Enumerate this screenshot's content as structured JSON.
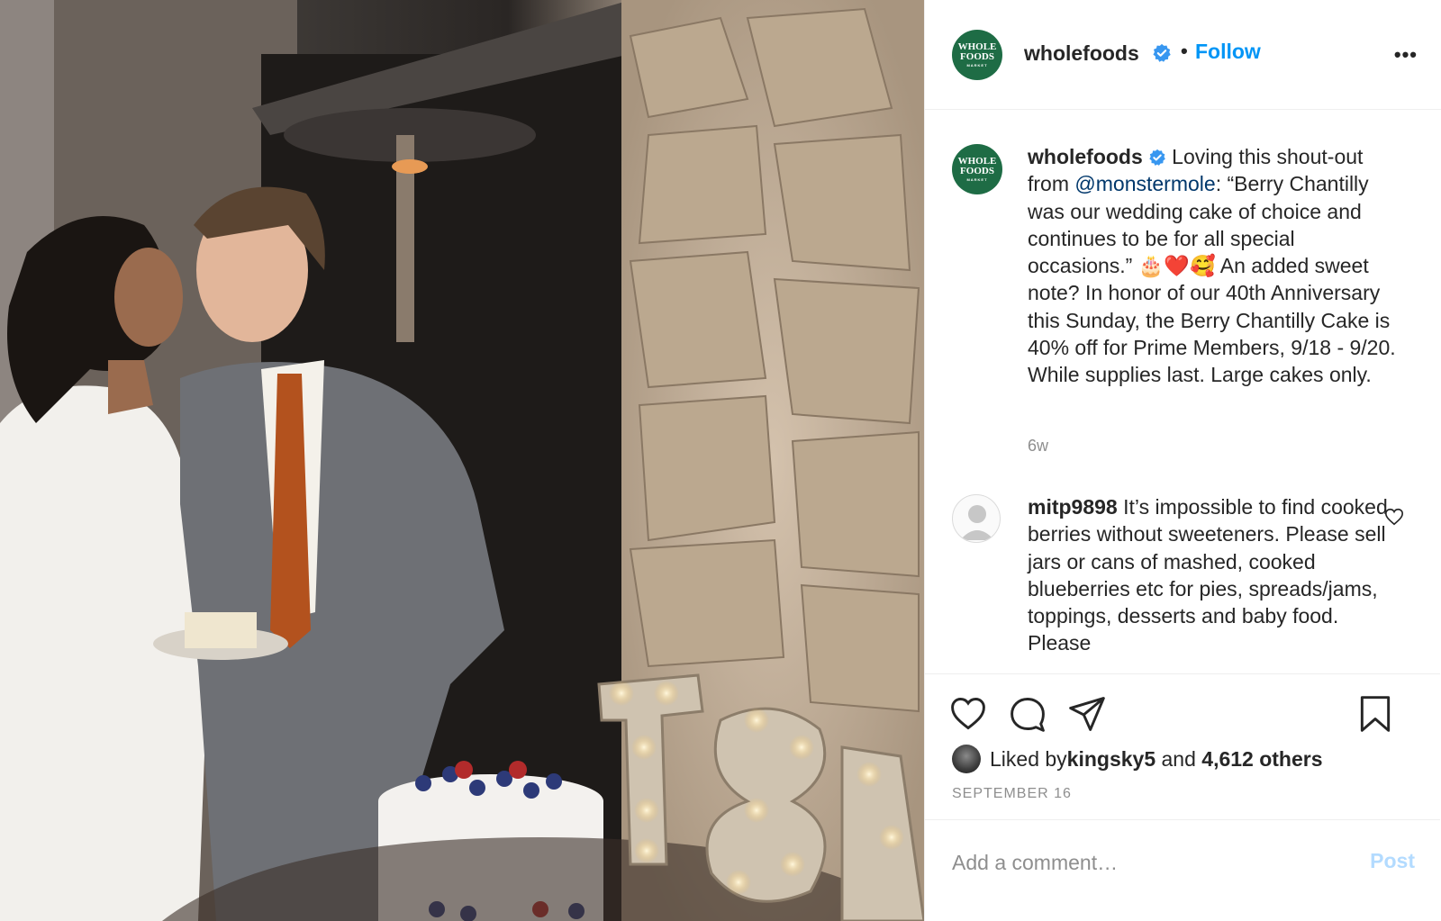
{
  "post": {
    "account": "wholefoods",
    "logo": {
      "line1": "WHOLE",
      "line2": "FOODS",
      "line3": "MARKET"
    },
    "follow_label": "Follow",
    "separator": "•",
    "more_label": "•••"
  },
  "caption": {
    "user": "wholefoods",
    "text_before_mention": " Loving this shout-out from ",
    "mention": "@monstermole",
    "text_after_mention": ": “Berry Chantilly was our wedding cake of choice and continues to be for all special occasions.” 🎂❤️🥰 An added sweet note? In honor of our 40th Anniversary this Sunday, the Berry Chantilly Cake is 40% off for Prime Members, 9/18 - 9/20. While supplies last. Large cakes only.",
    "time": "6w"
  },
  "comment": {
    "user": "mitp9898",
    "text": " It’s impossible to find cooked berries without sweeteners. Please sell jars or cans of mashed, cooked blueberries etc for pies, spreads/jams, toppings, desserts and baby food. Please"
  },
  "engagement": {
    "liked_prefix": "Liked by ",
    "liked_user": "kingsky5",
    "liked_middle": " and ",
    "liked_others": "4,612 others",
    "date": "SEPTEMBER 16"
  },
  "add_comment": {
    "placeholder": "Add a comment…",
    "post_label": "Post"
  },
  "colors": {
    "link_blue": "#0095f6",
    "brand_green": "#1e6c45",
    "verified_blue": "#3897f0",
    "post_disabled": "#b3dbff"
  }
}
